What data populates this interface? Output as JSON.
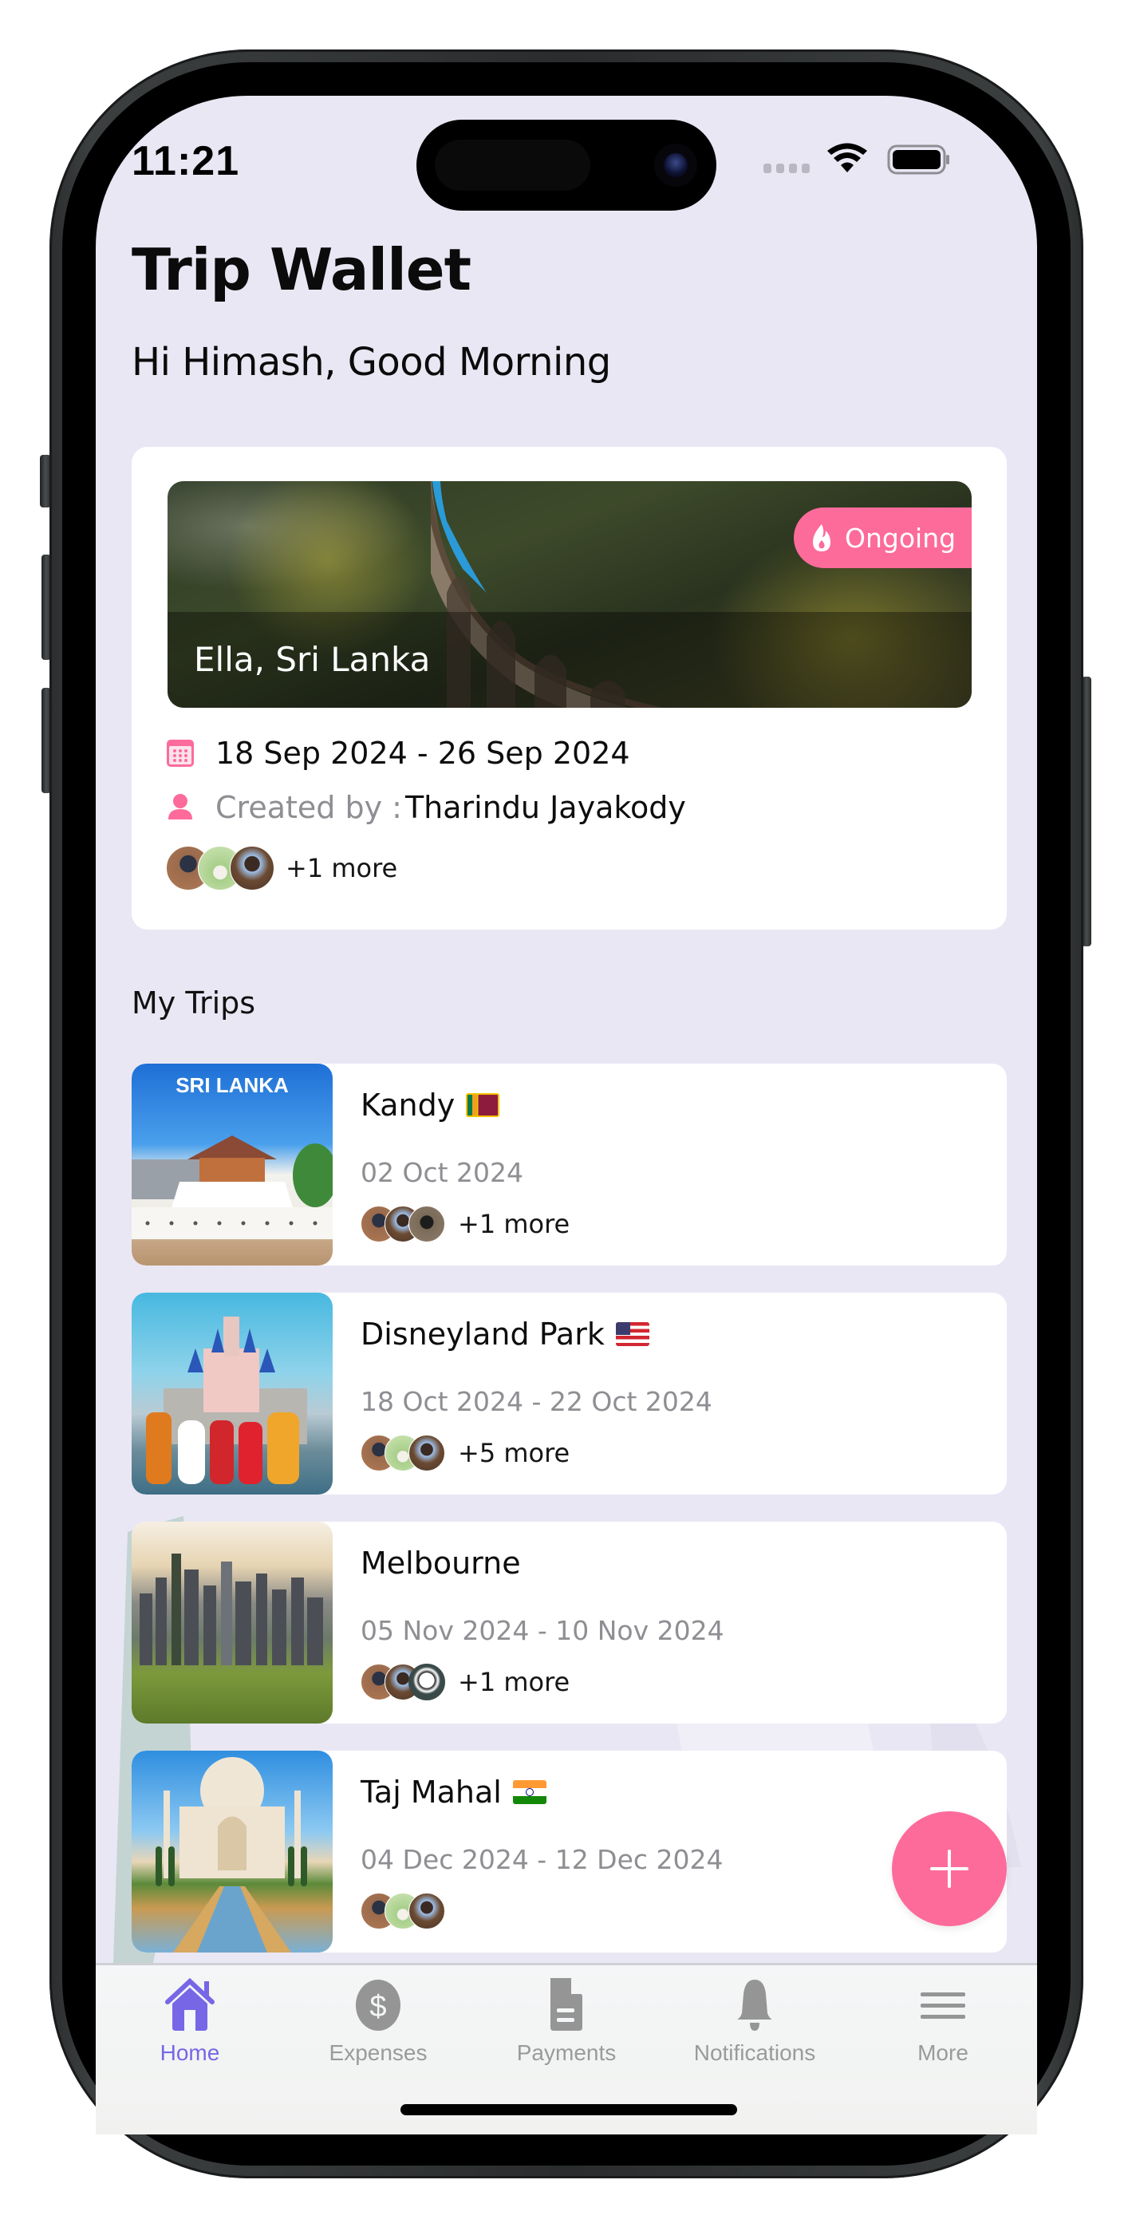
{
  "status_bar": {
    "time": "11:21",
    "icons": [
      "signal-dots-icon",
      "wifi-icon",
      "battery-icon"
    ]
  },
  "header": {
    "title": "Trip Wallet",
    "greeting": "Hi Himash, Good Morning"
  },
  "featured_trip": {
    "place": "Ella, Sri Lanka",
    "status": "Ongoing",
    "status_icon": "fire-icon",
    "dates": "18 Sep 2024 - 26 Sep 2024",
    "created_by_label": "Created by :",
    "created_by_name": "Tharindu Jayakody",
    "more": "+1 more",
    "avatars": 3
  },
  "section": {
    "title": "My Trips"
  },
  "trips": [
    {
      "name": "Kandy",
      "flag": "sri-lanka-flag",
      "dates": "02 Oct 2024",
      "more": "+1 more",
      "thumb_caption": "SRI LANKA"
    },
    {
      "name": "Disneyland Park",
      "flag": "usa-flag",
      "dates": "18 Oct 2024 - 22 Oct 2024",
      "more": "+5 more"
    },
    {
      "name": "Melbourne",
      "flag": "",
      "dates": "05 Nov 2024 - 10 Nov 2024",
      "more": "+1 more"
    },
    {
      "name": "Taj Mahal",
      "flag": "india-flag",
      "dates": "04 Dec 2024 - 12 Dec 2024",
      "more": ""
    }
  ],
  "fab": {
    "icon": "plus-icon"
  },
  "tabs": [
    {
      "label": "Home",
      "icon": "home-icon",
      "active": true
    },
    {
      "label": "Expenses",
      "icon": "dollar-icon",
      "active": false
    },
    {
      "label": "Payments",
      "icon": "document-icon",
      "active": false
    },
    {
      "label": "Notifications",
      "icon": "bell-icon",
      "active": false
    },
    {
      "label": "More",
      "icon": "menu-icon",
      "active": false
    }
  ],
  "colors": {
    "accent_pink": "#fd6b9b",
    "tab_active": "#7766e6",
    "tab_inactive": "#9a9a9a",
    "background": "#e9e7f3",
    "muted_text": "#8e8e93"
  }
}
